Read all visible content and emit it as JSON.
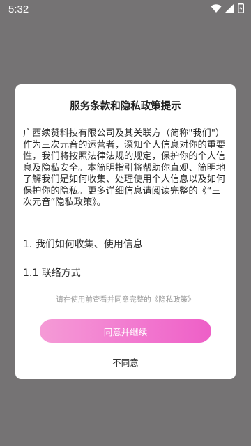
{
  "status_bar": {
    "time": "5:32",
    "icons": [
      "wifi-icon",
      "signal-icon",
      "battery-icon"
    ]
  },
  "dialog": {
    "title": "服务条款和隐私政策提示",
    "intro": "广西续赞科技有限公司及其关联方（简称\"我们\"）作为三次元音的运营者，深知个人信息对你的重要性，我们将按照法律法规的规定，保护你的个人信息及隐私安全。本简明指引将帮助你直观、简明地了解我们是如何收集、处理使用个人信息以及如何保护你的隐私。更多详细信息请阅读完整的《“三次元音”隐私政策》。",
    "section_1": "1. 我们如何收集、使用信息",
    "section_1_1": "1.1 联络方式",
    "consent_hint": "请在使用前查看并同意完整的《隐私政策》",
    "agree_label": "同意并继续",
    "decline_label": "不同意"
  },
  "colors": {
    "backdrop": "#757374",
    "dialog_bg": "#ffffff",
    "button_gradient_start": "#f59bd6",
    "button_gradient_end": "#ee5fc7",
    "hint_text": "#9a9a9a"
  }
}
